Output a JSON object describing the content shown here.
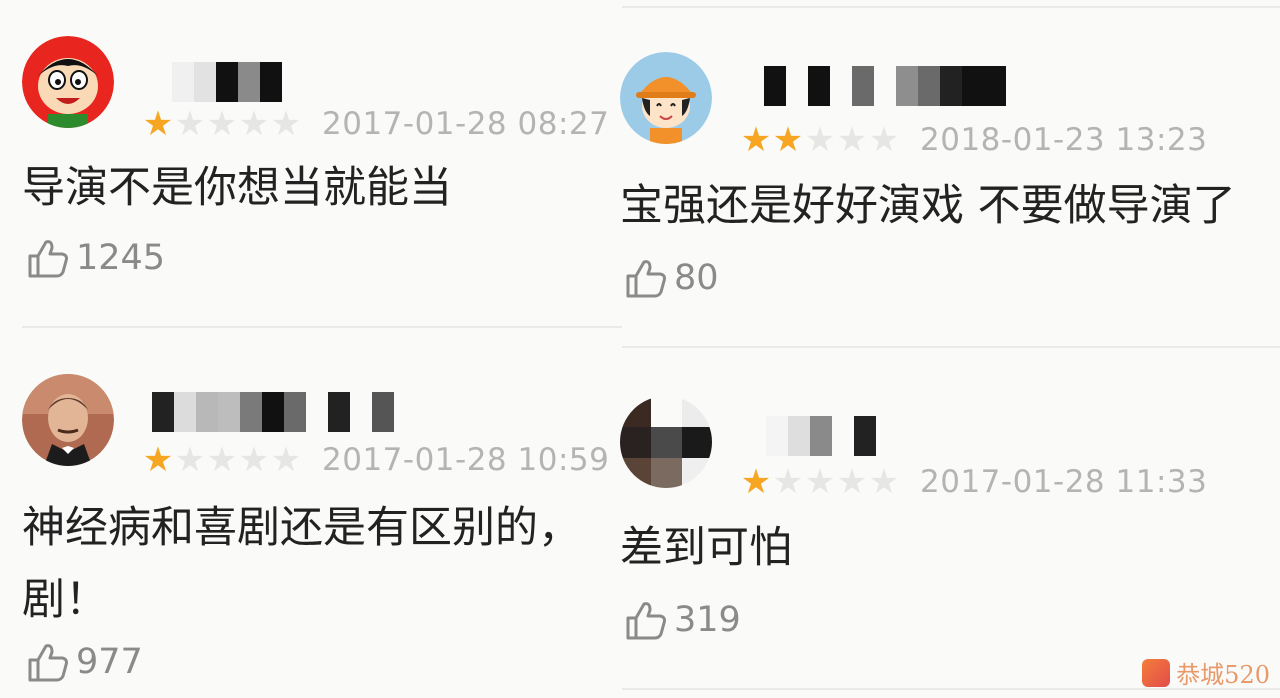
{
  "reviews": [
    {
      "likes": "1245",
      "date": "2017-01-28 08:27",
      "rating": 1,
      "comment": "导演不是你想当就能当",
      "avatar_icon": "cartoon-boy-avatar-icon"
    },
    {
      "likes": "80",
      "date": "2018-01-23 13:23",
      "rating": 2,
      "comment": "宝强还是好好演戏 不要做导演了",
      "avatar_icon": "cartoon-girl-hardhat-avatar-icon"
    },
    {
      "likes": "977",
      "date": "2017-01-28 10:59",
      "rating": 1,
      "comment": "神经病和喜剧还是有区别的，\n剧！",
      "avatar_icon": "man-photo-avatar-icon"
    },
    {
      "likes": "319",
      "date": "2017-01-28 11:33",
      "rating": 1,
      "comment": "差到可怕",
      "avatar_icon": "blurred-photo-avatar-icon"
    }
  ],
  "colors": {
    "star_on": "#f6a623",
    "star_off": "#e6e6e4",
    "date": "#b4b4b4",
    "comment": "#222222",
    "likes": "#8a8a8a"
  },
  "watermark": {
    "text": "恭城520"
  }
}
